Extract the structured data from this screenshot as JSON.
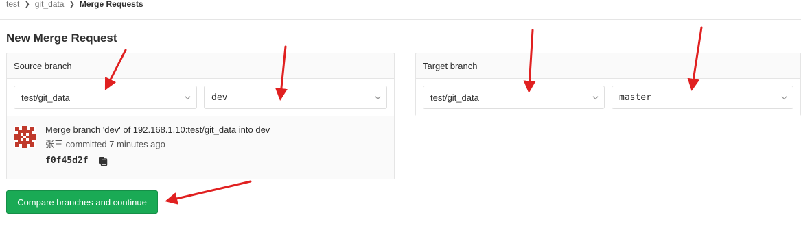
{
  "breadcrumb": {
    "items": [
      "test",
      "git_data"
    ],
    "current": "Merge Requests"
  },
  "page": {
    "title": "New Merge Request"
  },
  "source": {
    "header": "Source branch",
    "project": "test/git_data",
    "branch": "dev"
  },
  "target": {
    "header": "Target branch",
    "project": "test/git_data",
    "branch": "master"
  },
  "commit": {
    "title": "Merge branch 'dev' of 192.168.1.10:test/git_data into dev",
    "author": "张三",
    "meta": "committed 7 minutes ago",
    "sha": "f0f45d2f"
  },
  "actions": {
    "compare": "Compare branches and continue"
  },
  "colors": {
    "annotation": "#e02020",
    "button": "#1aaa55",
    "avatar": "#c0392b"
  },
  "icons": {
    "chevron": "chevron-down-icon",
    "copy": "copy-icon",
    "arrow": "annotation-arrow"
  }
}
